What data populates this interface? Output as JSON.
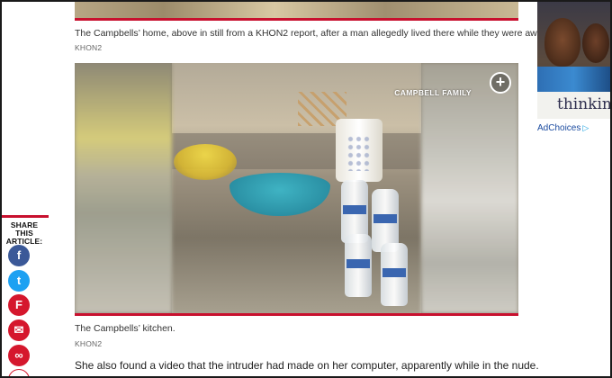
{
  "top_figure": {
    "caption": "The Campbells’ home, above in still from a KHON2 report, after a man allegedly lived there while they were away.",
    "credit": "KHON2"
  },
  "main_figure": {
    "watermark": "CAMPBELL FAMILY",
    "expand_symbol": "+",
    "caption": "The Campbells’ kitchen.",
    "credit": "KHON2"
  },
  "article": {
    "paragraph": "She also found a video that the intruder had made on her computer, apparently while in the nude."
  },
  "share": {
    "label": "SHARE THIS ARTICLE:",
    "buttons": [
      {
        "icon": "facebook-icon",
        "glyph": "f"
      },
      {
        "icon": "twitter-icon",
        "glyph": "t"
      },
      {
        "icon": "flipboard-icon",
        "glyph": "F"
      },
      {
        "icon": "email-icon",
        "glyph": "✉"
      },
      {
        "icon": "link-icon",
        "glyph": "∞"
      }
    ]
  },
  "ad": {
    "text": "thinkin",
    "adchoices": "AdChoices",
    "adchoices_icon": "▷"
  },
  "colors": {
    "accent_red": "#c8102e",
    "facebook": "#3b5998",
    "twitter": "#1da1f2"
  }
}
